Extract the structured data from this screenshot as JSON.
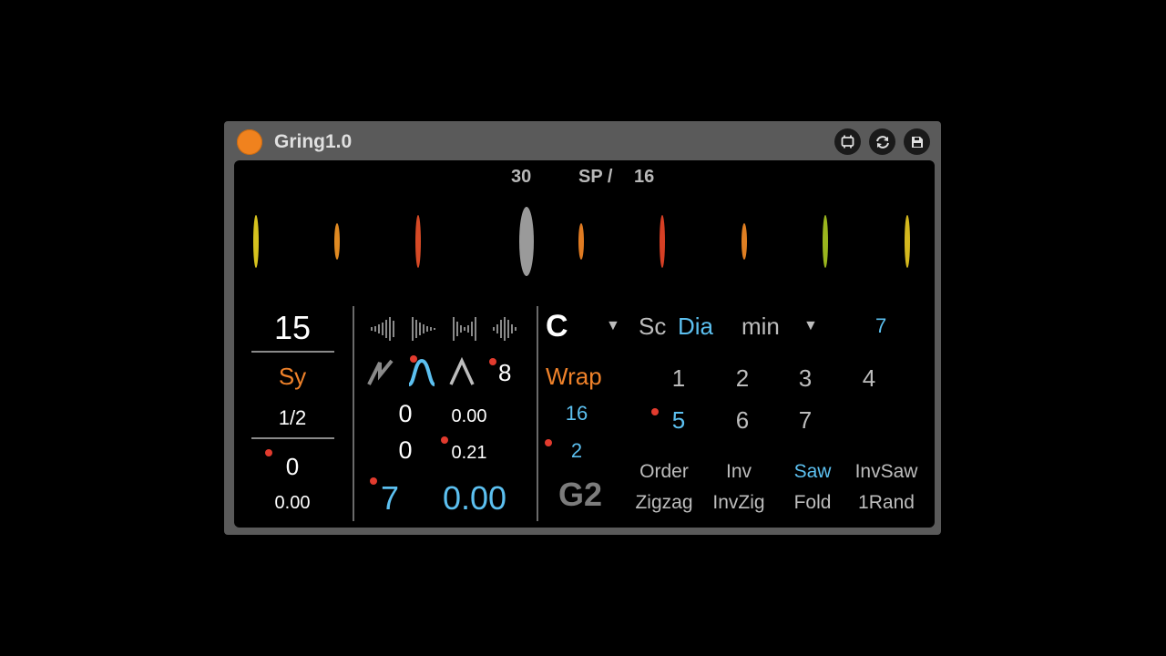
{
  "device": {
    "title": "Gring1.0",
    "buttons": [
      "clip-icon",
      "refresh-icon",
      "save-icon"
    ]
  },
  "header": {
    "value_left": "30",
    "sp_label": "SP /",
    "value_right": "16"
  },
  "steps": {
    "colors": [
      "#d6c21e",
      "#e08a22",
      "#d64a26",
      "#9a9a9a",
      "#e07b22",
      "#d63f24",
      "#e07f22",
      "#9ab51e",
      "#d4b81e"
    ]
  },
  "left": {
    "value_top": "15",
    "sync_label": "Sy",
    "rate": "1/2",
    "offset_int": "0",
    "offset_float": "0.00"
  },
  "mid": {
    "shape_icons": [
      "wave-icon-1",
      "wave-icon-2",
      "wave-icon-3",
      "wave-icon-4"
    ],
    "curve_icons": [
      "sawtooth-curve-icon",
      "bell-curve-icon",
      "triangle-curve-icon"
    ],
    "curve_value": "8",
    "row1_int": "0",
    "row1_float": "0.00",
    "row2_int": "0",
    "row2_float": "0.21",
    "big_int": "7",
    "big_float": "0.00"
  },
  "right": {
    "key": "C",
    "scale_label": "Sc",
    "scale_type": "Dia",
    "mode": "min",
    "mode_value": "7",
    "wrap_label": "Wrap",
    "wrap_value1": "16",
    "wrap_value2": "2",
    "note": "G2",
    "degrees": [
      "1",
      "2",
      "3",
      "4",
      "5",
      "6",
      "7"
    ],
    "selected_degree": "5",
    "patterns_row1": [
      "Order",
      "Inv",
      "Saw",
      "InvSaw"
    ],
    "patterns_row2": [
      "Zigzag",
      "InvZig",
      "Fold",
      "1Rand"
    ],
    "selected_pattern": "Saw"
  },
  "colors": {
    "accent_blue": "#5cc0f0",
    "accent_orange": "#f0822a",
    "dot_red": "#e23b2e"
  }
}
